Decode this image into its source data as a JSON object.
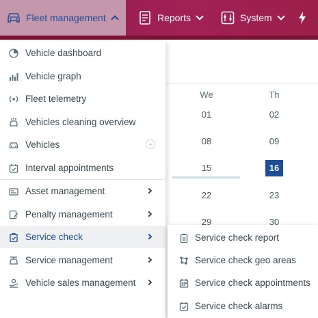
{
  "topnav": {
    "fleet_label": "Fleet management",
    "reports_label": "Reports",
    "system_label": "System"
  },
  "calendar": {
    "headers": [
      "We",
      "Th"
    ],
    "rows": [
      [
        "01",
        "02"
      ],
      [
        "08",
        "09"
      ],
      [
        "15",
        "16"
      ],
      [
        "22",
        "23"
      ],
      [
        "29",
        "30"
      ]
    ],
    "selected_day": "16"
  },
  "menu": {
    "items": [
      {
        "label": "Vehicle dashboard",
        "icon": "dashboard-icon"
      },
      {
        "label": "Vehicle graph",
        "icon": "graph-icon"
      },
      {
        "label": "Fleet telemetry",
        "icon": "telemetry-icon"
      },
      {
        "label": "Vehicles cleaning overview",
        "icon": "cleaning-icon"
      },
      {
        "label": "Vehicles",
        "icon": "car-icon"
      },
      {
        "label": "Interval appointments",
        "icon": "calendar-check-icon"
      },
      {
        "label": "Asset management",
        "icon": "asset-icon"
      },
      {
        "label": "Penalty management",
        "icon": "penalty-icon"
      },
      {
        "label": "Service check",
        "icon": "clipboard-check-icon"
      },
      {
        "label": "Service management",
        "icon": "service-icon"
      },
      {
        "label": "Vehicle sales management",
        "icon": "sales-icon"
      }
    ]
  },
  "submenu": {
    "items": [
      {
        "label": "Service check report",
        "icon": "report-icon"
      },
      {
        "label": "Service check geo areas",
        "icon": "geo-area-icon"
      },
      {
        "label": "Service check appointments",
        "icon": "calendar-icon"
      },
      {
        "label": "Service check alarms",
        "icon": "alarm-check-icon"
      }
    ]
  },
  "colors": {
    "topbar": "#a22155",
    "active_nav_bg": "#c497ad",
    "accent_blue": "#1f4e96",
    "text": "#37474f"
  }
}
